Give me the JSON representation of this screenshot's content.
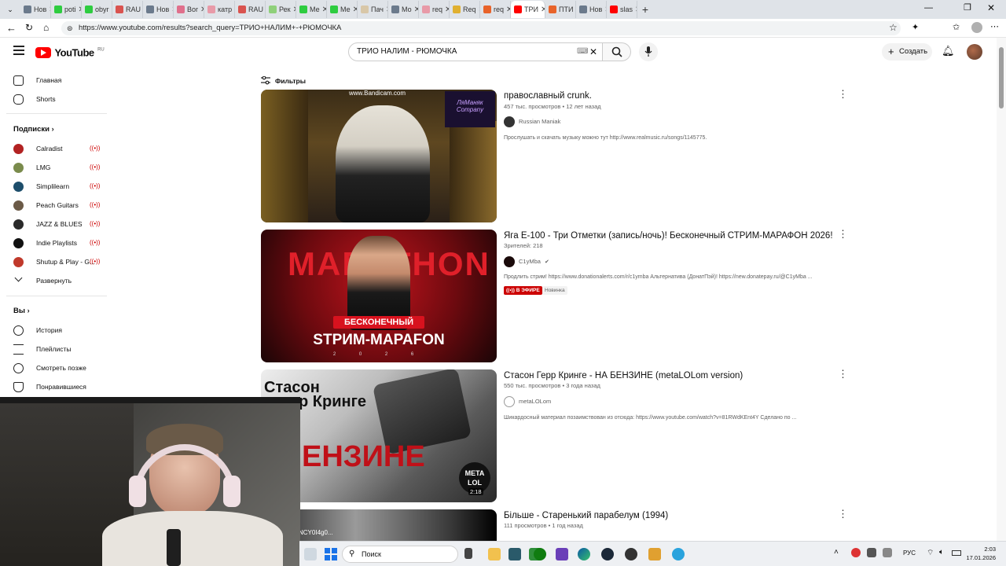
{
  "browser": {
    "tabs": [
      {
        "label": "Нов",
        "color": "#6b7a8c"
      },
      {
        "label": "poti",
        "color": "#2ecc40"
      },
      {
        "label": "obyr",
        "color": "#2ecc40"
      },
      {
        "label": "RAU",
        "color": "#d9534f"
      },
      {
        "label": "Нов",
        "color": "#6b7a8c"
      },
      {
        "label": "Bor",
        "color": "#e0708c"
      },
      {
        "label": "катр",
        "color": "#e89aa8"
      },
      {
        "label": "RAU",
        "color": "#d9534f"
      },
      {
        "label": "Рек",
        "color": "#8fd07a"
      },
      {
        "label": "Ме",
        "color": "#2ecc40"
      },
      {
        "label": "Ме",
        "color": "#2ecc40"
      },
      {
        "label": "Пач",
        "color": "#d8c7a8"
      },
      {
        "label": "Мо",
        "color": "#6b7a8c"
      },
      {
        "label": "req",
        "color": "#e89aa8"
      },
      {
        "label": "Req",
        "color": "#e0b030"
      },
      {
        "label": "req",
        "color": "#e8632a"
      },
      {
        "label": "ТРИ",
        "color": "#ff0000",
        "active": true
      },
      {
        "label": "ПТИ",
        "color": "#e8632a"
      },
      {
        "label": "Нов",
        "color": "#6b7a8c"
      },
      {
        "label": "slas",
        "color": "#ff0000"
      }
    ],
    "url": "https://www.youtube.com/results?search_query=ТРИО+НАЛИМ+-+РЮМОЧКА"
  },
  "header": {
    "logo_text": "YouTube",
    "logo_region": "RU",
    "search_value": "ТРИО НАЛИМ - РЮМОЧКА",
    "create_label": "Создать"
  },
  "sidebar": {
    "main": [
      {
        "label": "Главная",
        "icon": "home-icon"
      },
      {
        "label": "Shorts",
        "icon": "shorts-icon"
      }
    ],
    "subs_title": "Подписки",
    "subs": [
      {
        "label": "Calradist",
        "color": "#b22222"
      },
      {
        "label": "LMG",
        "color": "#7a8b4c"
      },
      {
        "label": "Simplilearn",
        "color": "#1d4e6b"
      },
      {
        "label": "Peach Guitars",
        "color": "#6b5a47"
      },
      {
        "label": "JAZZ & BLUES",
        "color": "#2a2a2a"
      },
      {
        "label": "Indie Playlists",
        "color": "#111111"
      },
      {
        "label": "Shutup & Play - G...",
        "color": "#c0392b"
      }
    ],
    "expand_label": "Развернуть",
    "you_title": "Вы",
    "you": [
      {
        "label": "История",
        "icon": "history-icon"
      },
      {
        "label": "Плейлисты",
        "icon": "playlists-icon"
      },
      {
        "label": "Смотреть позже",
        "icon": "watch-later-icon"
      },
      {
        "label": "Понравившиеся",
        "icon": "like-icon"
      }
    ]
  },
  "filters_label": "Фильтры",
  "results": [
    {
      "title": "православный crunk.",
      "meta": "457 тыс. просмотров • 12 лет назад",
      "channel": "Russian Maniak",
      "desc": "Прослушать и скачать музыку можно тут http://www.realmusic.ru/songs/1145775.",
      "thumb_watermark": "www.Bandicam.com",
      "thumb_badge": "ЛяМаняк Company",
      "colors": [
        "#2e2416",
        "#8a6a2c"
      ]
    },
    {
      "title": "Яга Е-100 - Три Отметки (запись/ночь)! Бесконечный СТРИМ-МАРАФОН 2026!",
      "meta": "Зрителей: 218",
      "channel": "C1yMba",
      "verified": "✔",
      "desc": "Продлить стрим! https://www.donationalerts.com/r/c1ymba Альтернатива (ДонатПэй)! https://new.donatepay.ru/@C1yMba ...",
      "badge_live": "В ЭФИРЕ",
      "badge_new": "Новинка",
      "thumb_big": "MARATHON",
      "thumb_ribbon": "БЕСКОНЕЧНЫЙ",
      "thumb_sub": "STРИМ-MAPAFON",
      "thumb_year": "2 0 2 6",
      "colors": [
        "#1a0506",
        "#b3121b"
      ]
    },
    {
      "title": "Стасон Герр Кринге - НА БЕНЗИНЕ (metaLOLom version)",
      "meta": "550 тыс. просмотров • 3 года назад",
      "channel": "metaLOLom",
      "desc": "Шикардосный материал позаимствован из отсюда: https://www.youtube.com/watch?v=81RWdKEnt4Y Сделано по ...",
      "thumb_line1": "Стасон",
      "thumb_line2": "р Кринге",
      "thumb_line3": "ЕНЗИНЕ",
      "thumb_logo": "META LOL",
      "duration": "2:18",
      "colors": [
        "#d9d9d9",
        "#3a3a3a"
      ]
    },
    {
      "title": "Більше - Старенький парабелум (1994)",
      "meta": "111 просмотров • 1 год назад",
      "thumb_text": "NCY0I4g0...",
      "colors": [
        "#1f1f1f",
        "#8a8a8a"
      ]
    }
  ],
  "taskbar": {
    "search_label": "Поиск",
    "lang": "РУС",
    "time": "2:03",
    "date": "17.01.2026"
  }
}
